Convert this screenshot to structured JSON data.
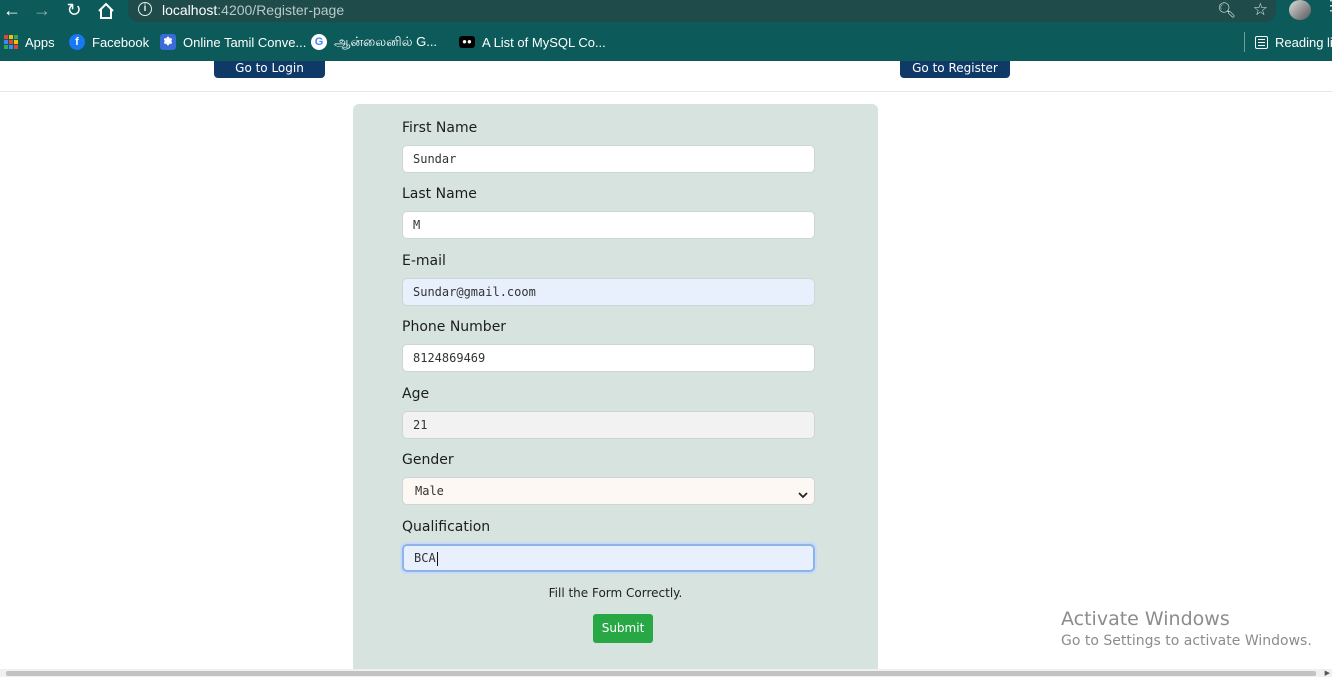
{
  "browser": {
    "url_host": "localhost",
    "url_rest": ":4200/Register-page",
    "bookmarks": [
      {
        "label": "Apps",
        "icon": "apps-grid-icon"
      },
      {
        "label": "Facebook",
        "icon": "facebook-icon"
      },
      {
        "label": "Online Tamil Conve...",
        "icon": "tamil-converter-icon"
      },
      {
        "label": "ஆன்லைனில் G...",
        "icon": "google-icon"
      },
      {
        "label": "A List of MySQL Co...",
        "icon": "medium-icon"
      }
    ],
    "reading_list": "Reading list"
  },
  "nav": {
    "login_label": "Go to Login",
    "register_label": "Go to Register"
  },
  "form": {
    "fields": [
      {
        "label": "First Name",
        "value": "Sundar"
      },
      {
        "label": "Last Name",
        "value": "M"
      },
      {
        "label": "E-mail",
        "value": "Sundar@gmail.coom"
      },
      {
        "label": "Phone Number",
        "value": "8124869469"
      },
      {
        "label": "Age",
        "value": "21"
      },
      {
        "label": "Gender",
        "value": "Male"
      },
      {
        "label": "Qualification",
        "value": "BCA"
      }
    ],
    "message": "Fill the Form Correctly.",
    "submit_label": "Submit"
  },
  "watermark": {
    "title": "Activate Windows",
    "subtitle": "Go to Settings to activate Windows."
  },
  "colors": {
    "browser_chrome": "#0c5a5a",
    "nav_button": "#0f3a68",
    "form_card": "#d6e3de",
    "submit": "#28a745"
  }
}
